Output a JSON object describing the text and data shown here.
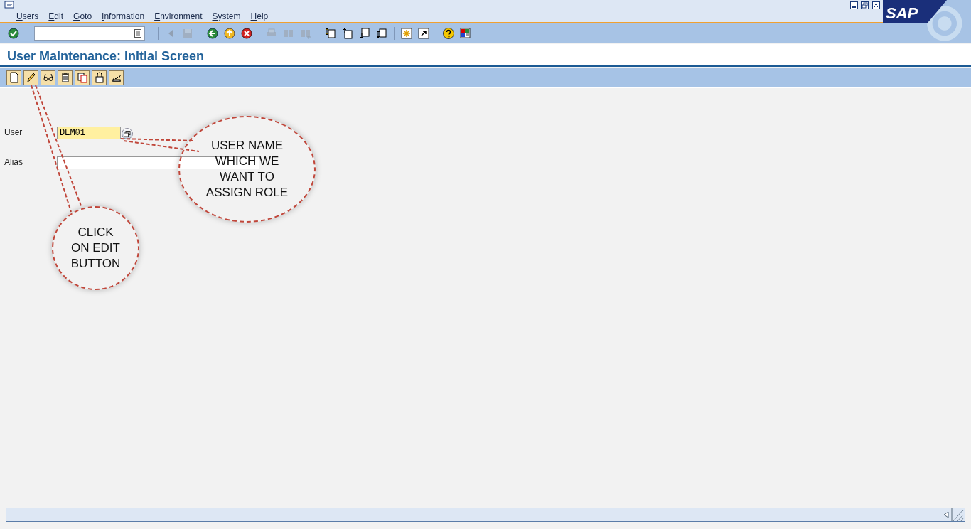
{
  "window": {
    "logo": "SAP"
  },
  "menu": [
    "Users",
    "Edit",
    "Goto",
    "Information",
    "Environment",
    "System",
    "Help"
  ],
  "toolbar": {
    "buttons": [
      {
        "kind": "enter",
        "disabled": false
      },
      {
        "kind": "sep"
      },
      {
        "kind": "prev",
        "disabled": true
      },
      {
        "kind": "save",
        "disabled": true
      },
      {
        "kind": "sep"
      },
      {
        "kind": "back",
        "disabled": false
      },
      {
        "kind": "exit",
        "disabled": false
      },
      {
        "kind": "cancel",
        "disabled": false
      },
      {
        "kind": "sep"
      },
      {
        "kind": "print",
        "disabled": true
      },
      {
        "kind": "find",
        "disabled": true
      },
      {
        "kind": "find-next",
        "disabled": true
      },
      {
        "kind": "sep"
      },
      {
        "kind": "first",
        "disabled": false
      },
      {
        "kind": "up",
        "disabled": false
      },
      {
        "kind": "down",
        "disabled": false
      },
      {
        "kind": "last",
        "disabled": false
      },
      {
        "kind": "sep"
      },
      {
        "kind": "session",
        "disabled": false
      },
      {
        "kind": "shortcut",
        "disabled": false
      },
      {
        "kind": "sep"
      },
      {
        "kind": "help",
        "disabled": false
      },
      {
        "kind": "layout",
        "disabled": false
      }
    ]
  },
  "title": "User Maintenance: Initial Screen",
  "app_toolbar": [
    {
      "kind": "create"
    },
    {
      "kind": "change"
    },
    {
      "kind": "display"
    },
    {
      "kind": "delete"
    },
    {
      "kind": "copy"
    },
    {
      "kind": "lock"
    },
    {
      "kind": "password"
    }
  ],
  "fields": [
    {
      "label": "User",
      "value": "DEM01",
      "required": true,
      "help": true
    },
    {
      "label": "Alias",
      "required": false,
      "help": false
    }
  ],
  "callouts": [
    {
      "text": "USER NAME\nWHICH WE\nWANT TO\nASSIGN ROLE",
      "kind": "field"
    },
    {
      "text": "CLICK\nON EDIT\nBUTTON",
      "kind": "toolbar"
    }
  ]
}
